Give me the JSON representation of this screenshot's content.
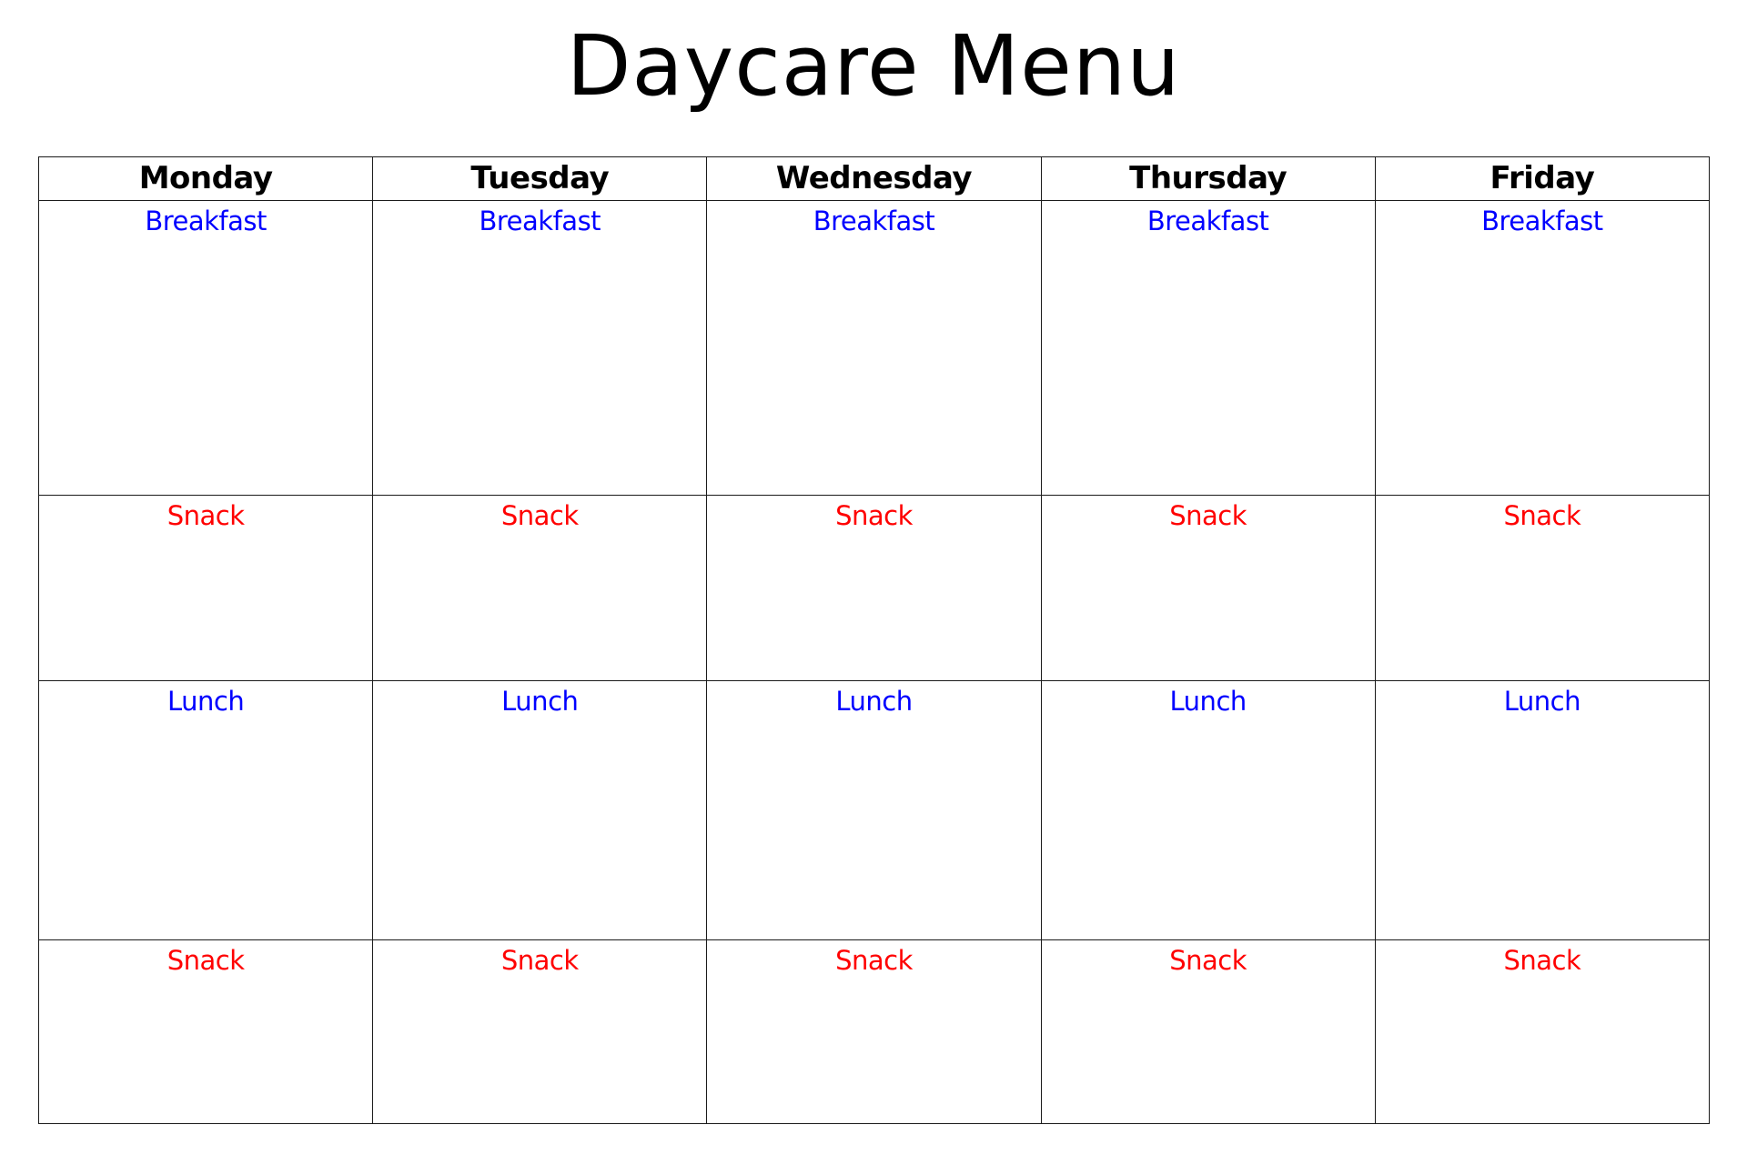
{
  "title": "Daycare Menu",
  "colors": {
    "breakfast": "#0000ff",
    "snack": "#ff0000",
    "lunch": "#0000ff"
  },
  "days": [
    "Monday",
    "Tuesday",
    "Wednesday",
    "Thursday",
    "Friday"
  ],
  "rows": [
    {
      "meal": "Breakfast",
      "type": "breakfast"
    },
    {
      "meal": "Snack",
      "type": "snack"
    },
    {
      "meal": "Lunch",
      "type": "lunch"
    },
    {
      "meal": "Snack",
      "type": "snack"
    }
  ]
}
